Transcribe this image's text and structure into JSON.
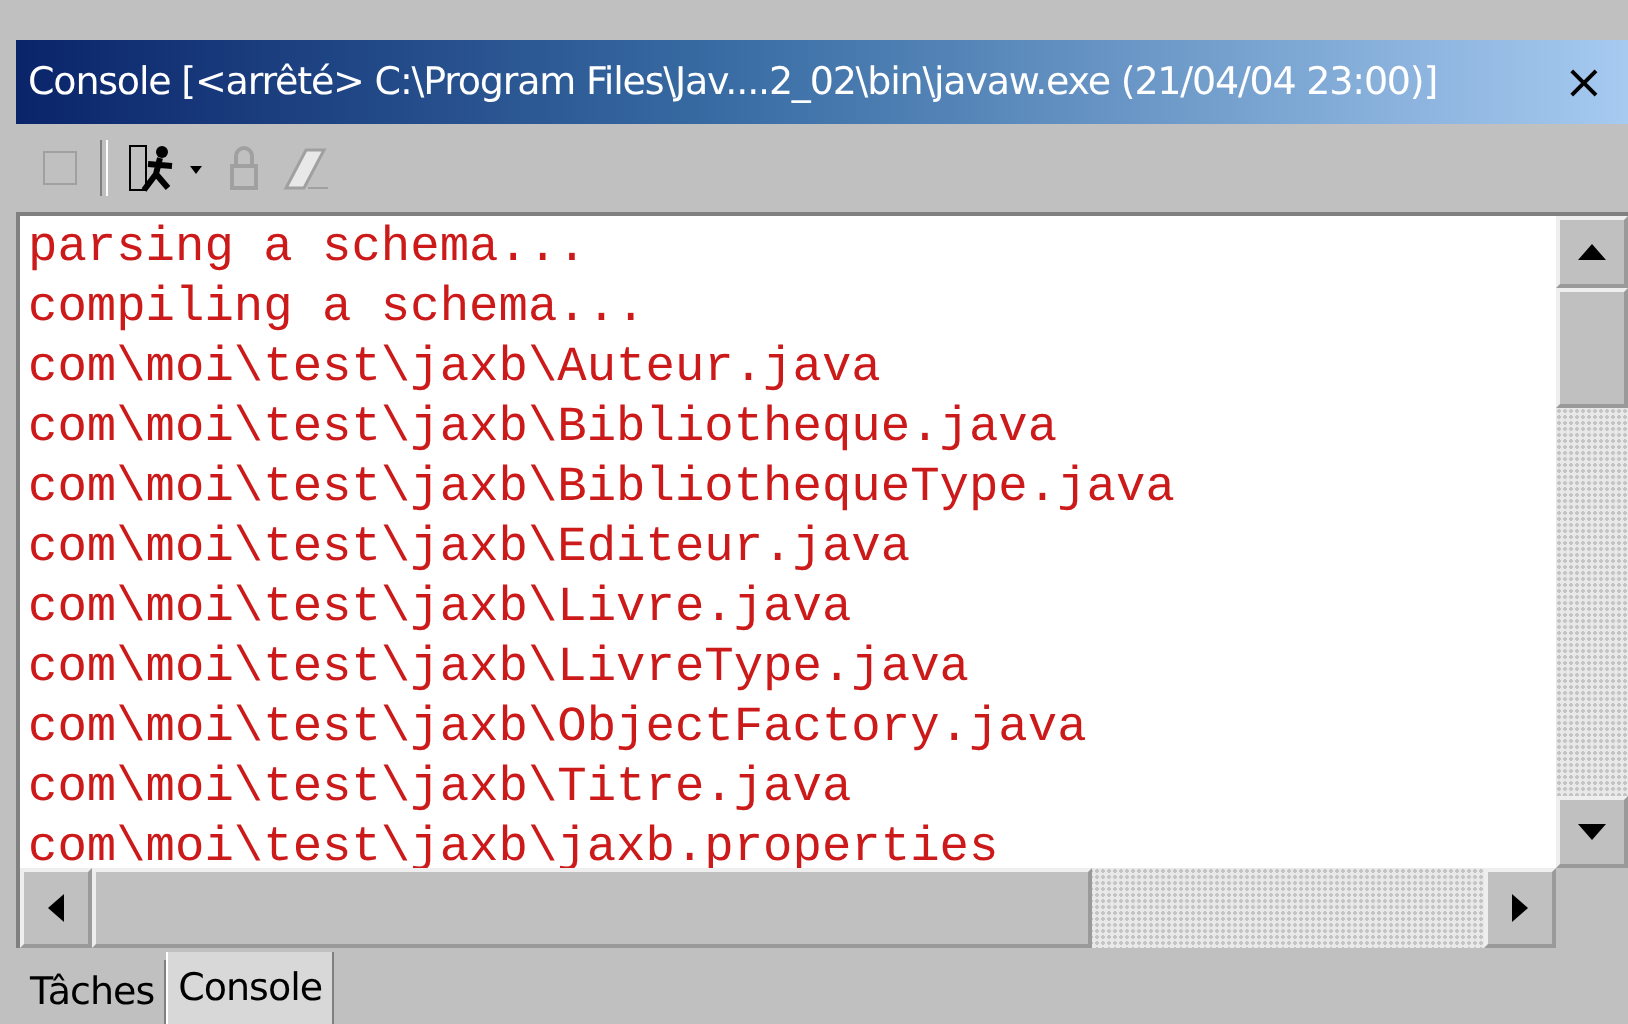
{
  "window": {
    "title": "Console [<arrêté> C:\\Program Files\\Jav....2_02\\bin\\javaw.exe (21/04/04 23:00)]",
    "close": "×"
  },
  "toolbar": [
    {
      "kind": "terminate",
      "disabled": true
    },
    {
      "kind": "run",
      "disabled": false
    },
    {
      "kind": "lock",
      "disabled": true
    },
    {
      "kind": "clear",
      "disabled": true
    }
  ],
  "console_lines": [
    "parsing a schema...",
    "compiling a schema...",
    "com\\moi\\test\\jaxb\\Auteur.java",
    "com\\moi\\test\\jaxb\\Bibliotheque.java",
    "com\\moi\\test\\jaxb\\BibliothequeType.java",
    "com\\moi\\test\\jaxb\\Editeur.java",
    "com\\moi\\test\\jaxb\\Livre.java",
    "com\\moi\\test\\jaxb\\LivreType.java",
    "com\\moi\\test\\jaxb\\ObjectFactory.java",
    "com\\moi\\test\\jaxb\\Titre.java",
    "com\\moi\\test\\jaxb\\jaxb.properties"
  ],
  "tabs": [
    {
      "label": "Tâches",
      "selected": false
    },
    {
      "label": "Console",
      "selected": true
    }
  ]
}
